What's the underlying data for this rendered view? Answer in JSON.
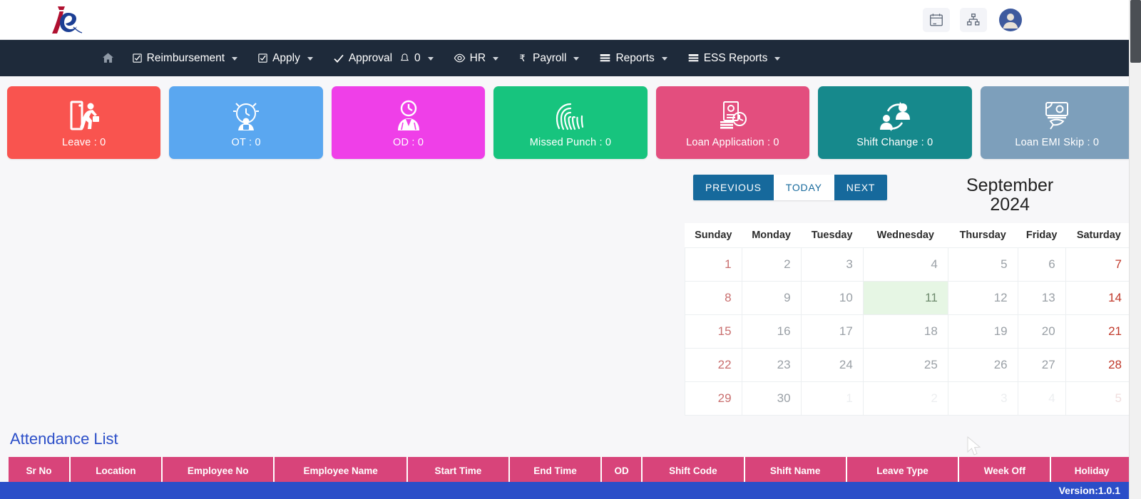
{
  "topbar": {
    "logo_alt": "iR logo",
    "icons": [
      {
        "name": "calendar-icon",
        "title": "Calendar"
      },
      {
        "name": "org-chart-icon",
        "title": "Organization"
      },
      {
        "name": "user-avatar-icon",
        "title": "Profile"
      }
    ]
  },
  "nav": {
    "items": [
      {
        "label": "",
        "icon": "home-icon",
        "caret": false
      },
      {
        "label": "Reimbursement",
        "icon": "check-square-icon",
        "caret": true
      },
      {
        "label": "Apply",
        "icon": "check-square-icon",
        "caret": true
      },
      {
        "label": "Approval",
        "icon": "check-icon",
        "caret": true,
        "badge_icon": "bell-icon",
        "badge": "0"
      },
      {
        "label": "HR",
        "icon": "eye-icon",
        "caret": true
      },
      {
        "label": "Payroll",
        "icon": "rupee-icon",
        "caret": true
      },
      {
        "label": "Reports",
        "icon": "list-icon",
        "caret": true
      },
      {
        "label": "ESS Reports",
        "icon": "list-icon",
        "caret": true
      }
    ]
  },
  "tiles": [
    {
      "label": "Leave : 0",
      "color": "#f9544f",
      "icon": "leave-door-icon"
    },
    {
      "label": "OT : 0",
      "color": "#5aa7f0",
      "icon": "overtime-clock-icon"
    },
    {
      "label": "OD : 0",
      "color": "#ef3fe8",
      "icon": "on-duty-clock-person-icon"
    },
    {
      "label": "Missed Punch : 0",
      "color": "#17c47e",
      "icon": "fingerprint-icon"
    },
    {
      "label": "Loan Application : 0",
      "color": "#e34e7e",
      "icon": "loan-money-icon"
    },
    {
      "label": "Shift Change : 0",
      "color": "#16898c",
      "icon": "shift-change-people-icon"
    },
    {
      "label": "Loan EMI Skip : 0",
      "color": "#7d9fbb",
      "icon": "loan-emi-skip-icon"
    }
  ],
  "calendar": {
    "buttons": {
      "previous": "PREVIOUS",
      "today": "TODAY",
      "next": "NEXT"
    },
    "title_month": "September",
    "title_year": "2024",
    "weekdays": [
      "Sunday",
      "Monday",
      "Tuesday",
      "Wednesday",
      "Thursday",
      "Friday",
      "Saturday"
    ],
    "highlight_day": "11",
    "weeks": [
      [
        {
          "d": "1",
          "t": "sun"
        },
        {
          "d": "2",
          "t": "wd"
        },
        {
          "d": "3",
          "t": "wd"
        },
        {
          "d": "4",
          "t": "wd"
        },
        {
          "d": "5",
          "t": "wd"
        },
        {
          "d": "6",
          "t": "wd"
        },
        {
          "d": "7",
          "t": "sat"
        }
      ],
      [
        {
          "d": "8",
          "t": "sun"
        },
        {
          "d": "9",
          "t": "wd"
        },
        {
          "d": "10",
          "t": "wd"
        },
        {
          "d": "11",
          "t": "today"
        },
        {
          "d": "12",
          "t": "wd"
        },
        {
          "d": "13",
          "t": "wd"
        },
        {
          "d": "14",
          "t": "sat"
        }
      ],
      [
        {
          "d": "15",
          "t": "sun"
        },
        {
          "d": "16",
          "t": "wd"
        },
        {
          "d": "17",
          "t": "wd"
        },
        {
          "d": "18",
          "t": "wd"
        },
        {
          "d": "19",
          "t": "wd"
        },
        {
          "d": "20",
          "t": "wd"
        },
        {
          "d": "21",
          "t": "sat"
        }
      ],
      [
        {
          "d": "22",
          "t": "sun"
        },
        {
          "d": "23",
          "t": "wd"
        },
        {
          "d": "24",
          "t": "wd"
        },
        {
          "d": "25",
          "t": "wd"
        },
        {
          "d": "26",
          "t": "wd"
        },
        {
          "d": "27",
          "t": "wd"
        },
        {
          "d": "28",
          "t": "sat"
        }
      ],
      [
        {
          "d": "29",
          "t": "sun"
        },
        {
          "d": "30",
          "t": "wd"
        },
        {
          "d": "1",
          "t": "other"
        },
        {
          "d": "2",
          "t": "other"
        },
        {
          "d": "3",
          "t": "other"
        },
        {
          "d": "4",
          "t": "other"
        },
        {
          "d": "5",
          "t": "other-sat"
        }
      ]
    ]
  },
  "attendance": {
    "title": "Attendance List",
    "columns": [
      "Sr No",
      "Location",
      "Employee No",
      "Employee Name",
      "Start Time",
      "End Time",
      "OD",
      "Shift Code",
      "Shift Name",
      "Leave Type",
      "Week Off",
      "Holiday"
    ],
    "rows": []
  },
  "footer": {
    "version": "Version:1.0.1"
  }
}
